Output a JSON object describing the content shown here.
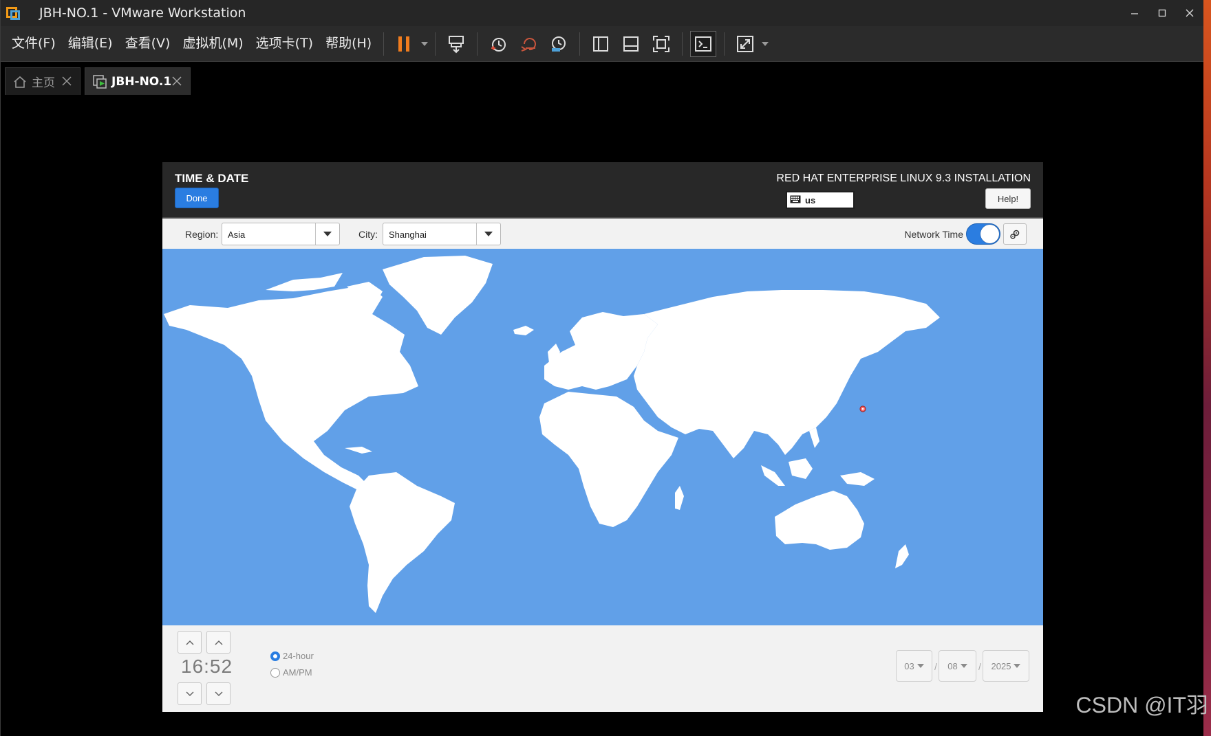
{
  "window": {
    "title": "JBH-NO.1 - VMware Workstation",
    "minimize": "—",
    "maximize": "☐",
    "close": "✕"
  },
  "menu": {
    "items": [
      "文件(F)",
      "编辑(E)",
      "查看(V)",
      "虚拟机(M)",
      "选项卡(T)",
      "帮助(H)"
    ]
  },
  "toolbar": {
    "accent_color": "#f07c1e",
    "icons": [
      "pause-icon",
      "send-ctrl-alt-del-icon",
      "snapshot-icon",
      "revert-snapshot-icon",
      "snapshot-manager-icon",
      "library-view-icon",
      "thumbnail-view-icon",
      "fullscreen-icon",
      "console-view-icon",
      "stretch-guest-icon"
    ]
  },
  "tabs": [
    {
      "label": "主页",
      "icon": "home-icon"
    },
    {
      "label": "JBH-NO.1",
      "icon": "vm-icon"
    }
  ],
  "installer": {
    "spoke_title": "TIME & DATE",
    "done_label": "Done",
    "product_title": "RED HAT ENTERPRISE LINUX 9.3 INSTALLATION",
    "keyboard_layout": "us",
    "help_label": "Help!",
    "region_label": "Region:",
    "region_value": "Asia",
    "city_label": "City:",
    "city_value": "Shanghai",
    "network_time_label": "Network Time",
    "network_time_on": true,
    "map_color": "#61a0e8",
    "selected_city_marker": "Shanghai",
    "time": "16:52",
    "format_24h": "24-hour",
    "format_ampm": "AM/PM",
    "selected_format": "24-hour",
    "month": "03",
    "day": "08",
    "year": "2025",
    "date_separator": "/"
  },
  "watermark": "CSDN @IT羽"
}
